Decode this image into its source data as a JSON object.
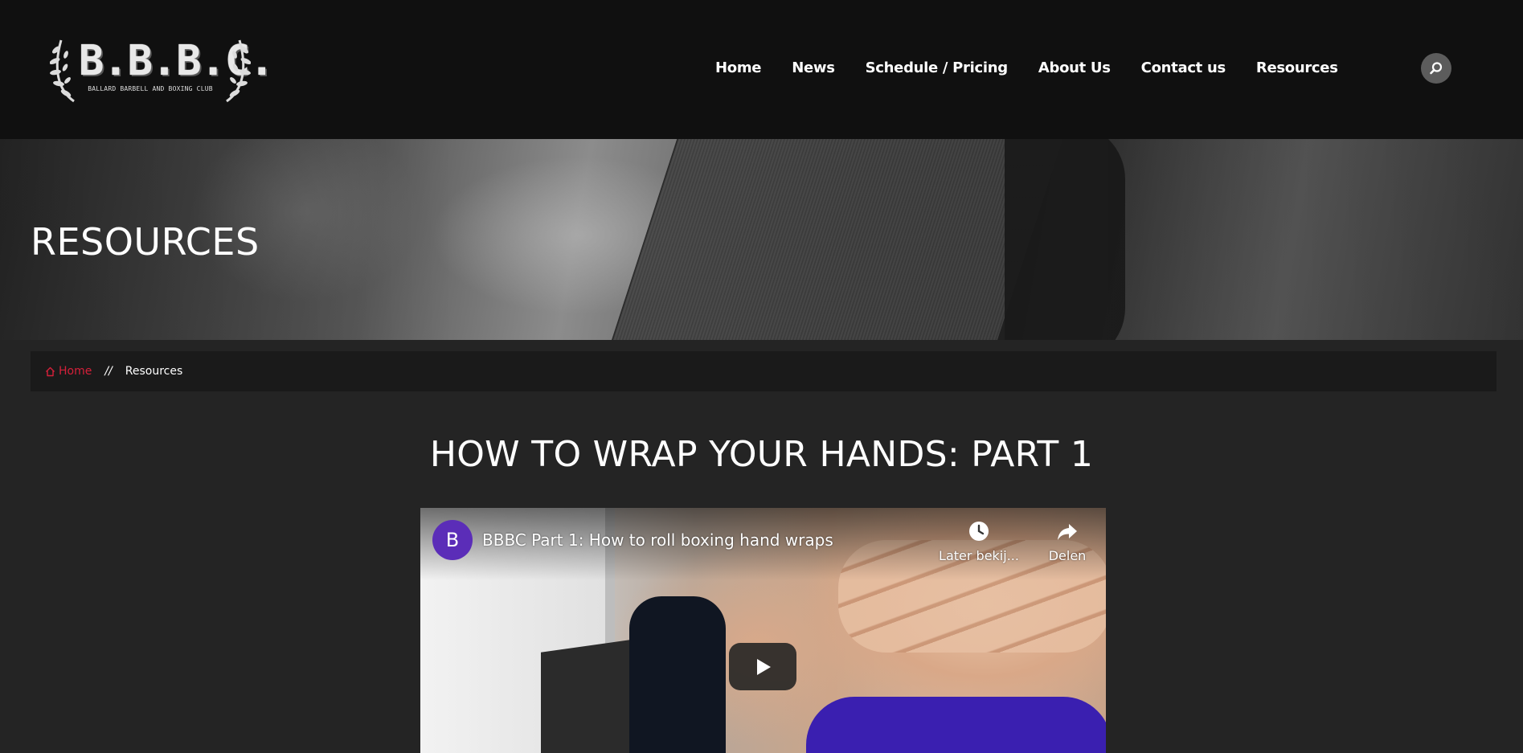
{
  "logo": {
    "title": "B.B.B.C.",
    "subtitle": "BALLARD BARBELL AND BOXING CLUB"
  },
  "nav": {
    "items": [
      {
        "label": "Home"
      },
      {
        "label": "News"
      },
      {
        "label": "Schedule / Pricing"
      },
      {
        "label": "About Us"
      },
      {
        "label": "Contact us"
      },
      {
        "label": "Resources"
      }
    ],
    "search_icon": "search-icon"
  },
  "hero": {
    "title": "RESOURCES"
  },
  "breadcrumb": {
    "home": "Home",
    "separator": "//",
    "current": "Resources",
    "home_color": "#d6203a"
  },
  "article": {
    "title": "HOW TO WRAP YOUR HANDS: PART 1"
  },
  "video": {
    "channel_initial": "B",
    "title": "BBBC Part 1: How to roll boxing hand wraps",
    "watch_later_label": "Later bekij...",
    "share_label": "Delen",
    "avatar_color": "#5b2db8"
  },
  "colors": {
    "header_bg": "#101010",
    "page_bg": "#242424",
    "accent": "#d6203a"
  }
}
